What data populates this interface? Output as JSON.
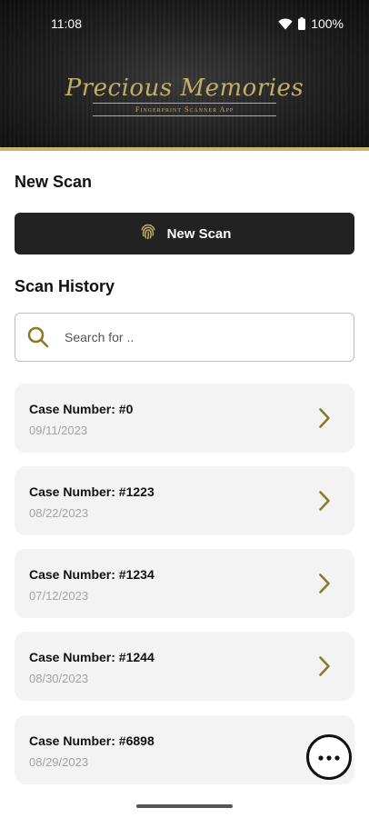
{
  "status_bar": {
    "time": "11:08",
    "battery": "100%"
  },
  "branding": {
    "title": "Precious Memories",
    "subtitle": "Fingerprint Scanner App"
  },
  "new_scan_section": {
    "title": "New Scan",
    "button_label": "New Scan"
  },
  "history_section": {
    "title": "Scan History",
    "search_placeholder": "Search for .."
  },
  "scans": [
    {
      "case": "Case Number: #0",
      "date": "09/11/2023"
    },
    {
      "case": "Case Number: #1223",
      "date": "08/22/2023"
    },
    {
      "case": "Case Number: #1234",
      "date": "07/12/2023"
    },
    {
      "case": "Case Number: #1244",
      "date": "08/30/2023"
    },
    {
      "case": "Case Number: #6898",
      "date": "08/29/2023"
    }
  ],
  "colors": {
    "accent_gold": "#8a7a2a",
    "header_border": "#c8b66f",
    "button_bg": "#222222",
    "card_bg": "#f3f3f3"
  },
  "icons": {
    "fingerprint": "fingerprint-icon",
    "search": "search-icon",
    "chevron": "chevron-right-icon",
    "more": "more-horizontal-icon"
  }
}
